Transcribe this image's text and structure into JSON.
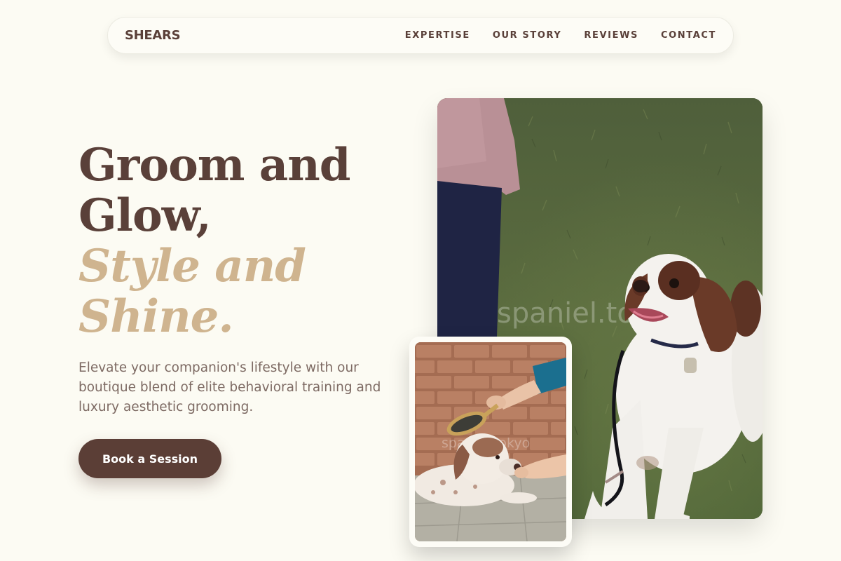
{
  "nav": {
    "brand": "SHEARS",
    "links": [
      "EXPERTISE",
      "OUR STORY",
      "REVIEWS",
      "CONTACT"
    ]
  },
  "hero": {
    "headline_line1": "Groom and",
    "headline_line2": "Glow,",
    "headline_accent_line1": "Style and",
    "headline_accent_line2": "Shine.",
    "subtitle": "Elevate your companion's lifestyle with our boutique blend of elite behavioral training and luxury aesthetic grooming.",
    "cta_label": "Book a Session"
  },
  "images": {
    "main_alt": "Springer spaniel lying on grass looking up",
    "main_watermark": "spaniel.tokyo",
    "secondary_alt": "Puppy being brushed in front of a brick wall",
    "secondary_watermark": "spaniel.tokyo"
  },
  "colors": {
    "background": "#fcfbf3",
    "primary_brown": "#5a4039",
    "accent_tan": "#cfb48f",
    "button": "#5b3e36"
  }
}
